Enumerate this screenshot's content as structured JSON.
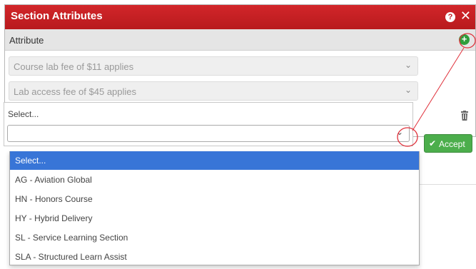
{
  "dialog": {
    "title": "Section Attributes",
    "accent_color": "#c01e21",
    "icons": {
      "help": "question-circle-icon",
      "close": "close-icon",
      "add": "plus-circle-icon",
      "delete": "trash-icon",
      "accept": "check-icon"
    }
  },
  "table": {
    "header_label": "Attribute",
    "rows": [
      {
        "value": "Course lab fee of $11 applies"
      },
      {
        "value": "Lab access fee of $45 applies"
      }
    ]
  },
  "new_row": {
    "placeholder": "Select...",
    "search_value": "",
    "accept_label": "Accept",
    "accept_color": "#4cae4c"
  },
  "dropdown": {
    "options": [
      {
        "label": "Select...",
        "selected": true
      },
      {
        "label": "AG - Aviation Global",
        "selected": false
      },
      {
        "label": "HN - Honors Course",
        "selected": false
      },
      {
        "label": "HY - Hybrid Delivery",
        "selected": false
      },
      {
        "label": "SL - Service Learning Section",
        "selected": false
      },
      {
        "label": "SLA - Structured Learn Assist",
        "selected": false
      }
    ],
    "highlight_color": "#3875d7"
  },
  "annotation_color": "#e0303a"
}
